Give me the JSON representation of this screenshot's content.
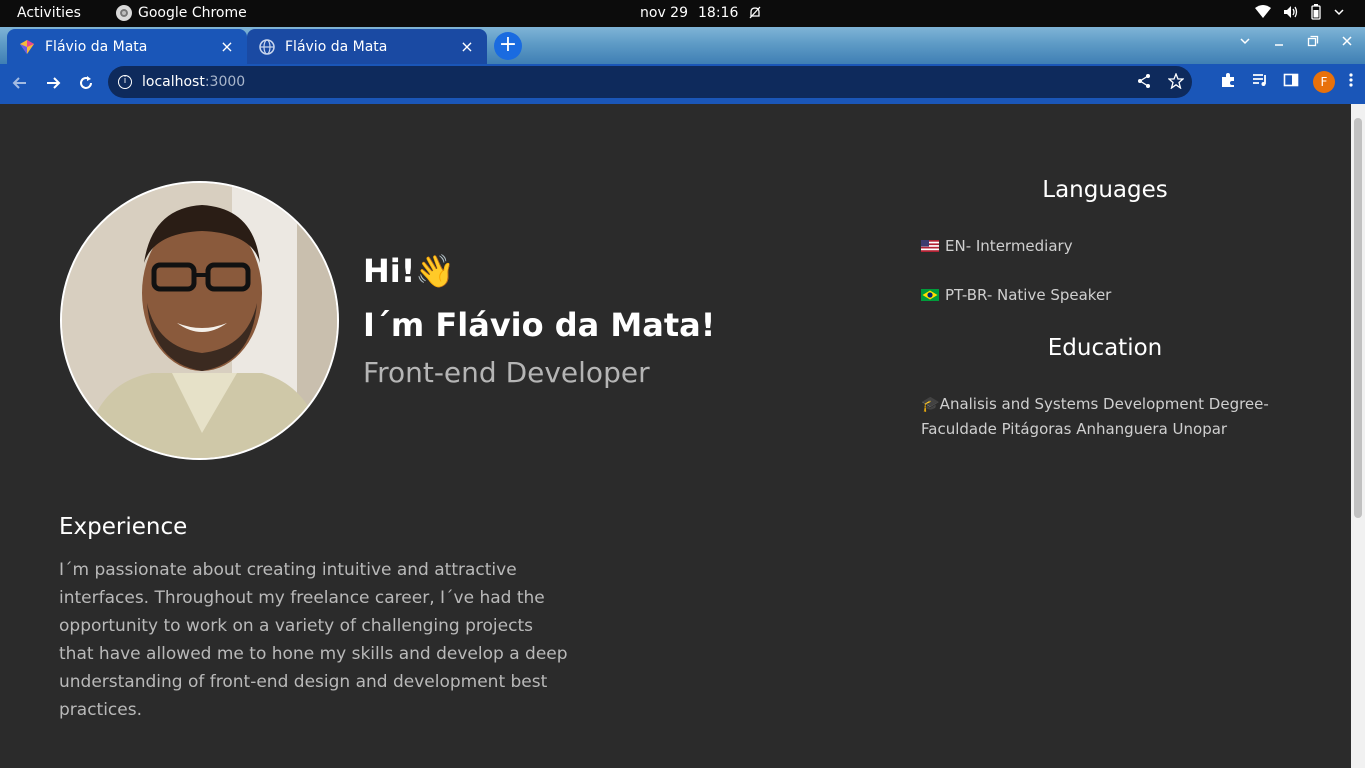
{
  "os": {
    "activities": "Activities",
    "app_name": "Google Chrome",
    "date": "nov 29",
    "time": "18:16"
  },
  "browser": {
    "tabs": [
      {
        "title": "Flávio da Mata",
        "active": true
      },
      {
        "title": "Flávio da Mata",
        "active": false
      }
    ],
    "close_glyph": "×",
    "new_tab_glyph": "+",
    "url_host": "localhost",
    "url_port": ":3000",
    "profile_initial": "F"
  },
  "hero": {
    "greeting": "Hi!👋",
    "name": "I´m Flávio da Mata!",
    "role": "Front-end Developer"
  },
  "experience": {
    "title": "Experience",
    "text": "I´m passionate about creating intuitive and attractive interfaces. Throughout my freelance career, I´ve had the opportunity to work on a variety of challenging projects that have allowed me to hone my skills and develop a deep understanding of front-end design and development best practices."
  },
  "languages": {
    "title": "Languages",
    "items": [
      {
        "flag": "us",
        "text": "EN- Intermediary"
      },
      {
        "flag": "br",
        "text": "PT-BR- Native Speaker"
      }
    ]
  },
  "education": {
    "title": "Education",
    "text": "🎓Analisis and Systems Development Degree- Faculdade Pitágoras Anhanguera Unopar"
  },
  "colors": {
    "page_bg": "#2b2b2b",
    "chrome_blue": "#1a56b8",
    "muted_text": "#b9b9b9"
  }
}
